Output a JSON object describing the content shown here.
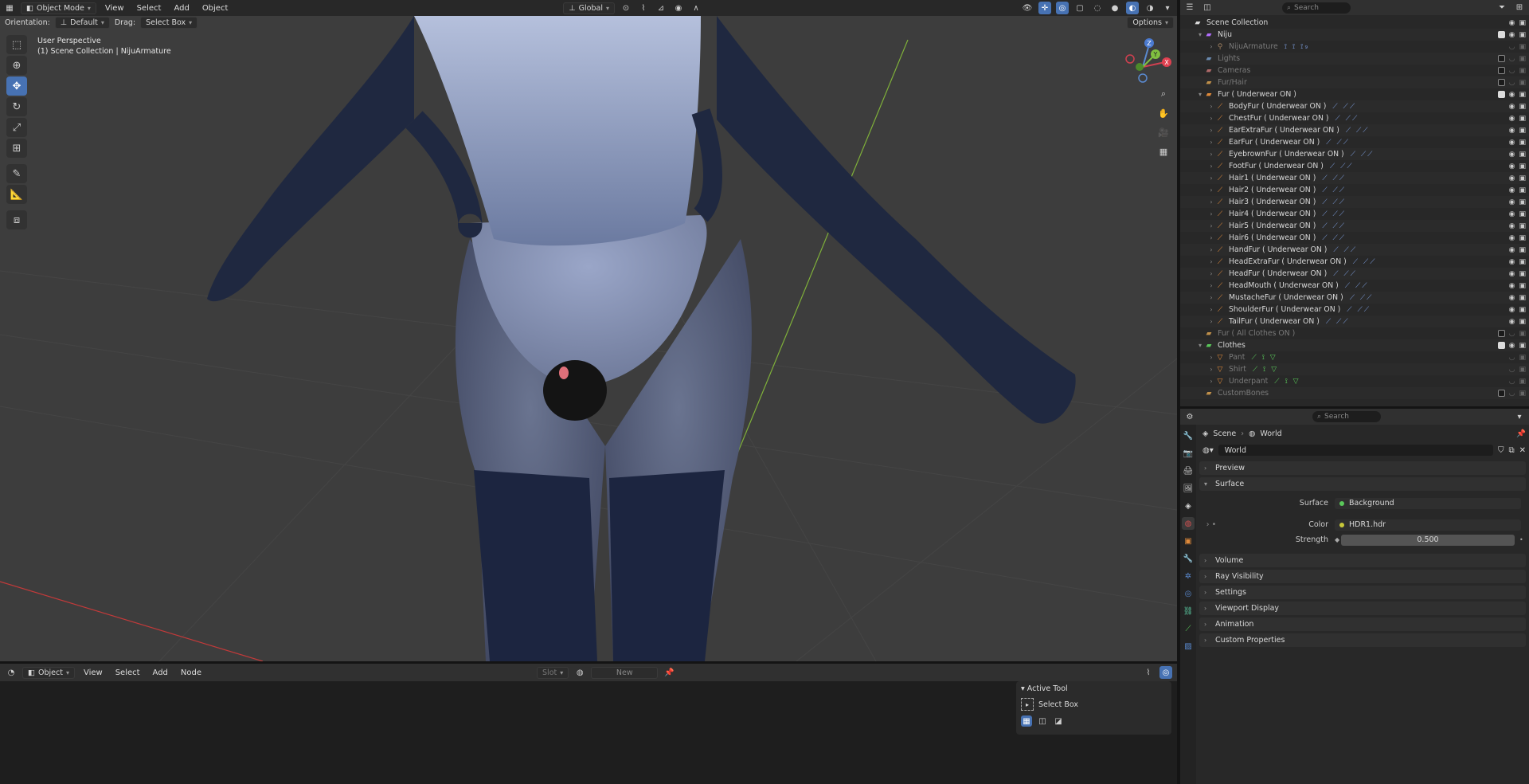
{
  "viewport": {
    "header": {
      "mode": "Object Mode",
      "menus": [
        "View",
        "Select",
        "Add",
        "Object"
      ],
      "transform": "Global"
    },
    "tool_settings": {
      "orientation_label": "Orientation:",
      "orientation_value": "Default",
      "drag_label": "Drag:",
      "drag_value": "Select Box",
      "options": "Options"
    },
    "info_line1": "User Perspective",
    "info_line2": "(1) Scene Collection | NijuArmature",
    "gizmo": {
      "x": "X",
      "y": "Y",
      "z": "Z"
    }
  },
  "node_editor": {
    "mode": "Object",
    "menus": [
      "View",
      "Select",
      "Add",
      "Node"
    ],
    "slot": "Slot",
    "new": "New",
    "active_tool": {
      "title": "Active Tool",
      "tool": "Select Box"
    }
  },
  "outliner": {
    "search_placeholder": "Search",
    "rows": [
      {
        "label": "Scene Collection",
        "indent": 0,
        "twisty": "",
        "icon": "collection-icon",
        "color": "#d8d8d8",
        "dim": false,
        "check": "",
        "extras": ""
      },
      {
        "label": "Niju",
        "indent": 1,
        "twisty": "▾",
        "icon": "collection-icon",
        "color": "#b36eff",
        "dim": false,
        "check": "on",
        "extras": ""
      },
      {
        "label": "NijuArmature",
        "indent": 2,
        "twisty": "›",
        "icon": "armature-icon",
        "color": "#a08060",
        "dim": true,
        "check": "",
        "extras": "⟟ ⟟ ⟟₉"
      },
      {
        "label": "Lights",
        "indent": 1,
        "twisty": "",
        "icon": "collection-icon",
        "color": "#6a8ab0",
        "dim": true,
        "check": "off",
        "extras": ""
      },
      {
        "label": "Cameras",
        "indent": 1,
        "twisty": "",
        "icon": "collection-icon",
        "color": "#b06a6a",
        "dim": true,
        "check": "off",
        "extras": ""
      },
      {
        "label": "Fur/Hair",
        "indent": 1,
        "twisty": "",
        "icon": "collection-icon",
        "color": "#c0904a",
        "dim": true,
        "check": "off",
        "extras": ""
      },
      {
        "label": "Fur ( Underwear ON )",
        "indent": 1,
        "twisty": "▾",
        "icon": "collection-icon",
        "color": "#e08a3a",
        "dim": false,
        "check": "on",
        "extras": ""
      },
      {
        "label": "BodyFur ( Underwear ON )",
        "indent": 2,
        "twisty": "›",
        "icon": "curves-icon",
        "color": "#e08a3a",
        "dim": false,
        "check": "",
        "extras": "⟋ ⟋⟋"
      },
      {
        "label": "ChestFur ( Underwear ON )",
        "indent": 2,
        "twisty": "›",
        "icon": "curves-icon",
        "color": "#e08a3a",
        "dim": false,
        "check": "",
        "extras": "⟋ ⟋⟋"
      },
      {
        "label": "EarExtraFur ( Underwear ON )",
        "indent": 2,
        "twisty": "›",
        "icon": "curves-icon",
        "color": "#e08a3a",
        "dim": false,
        "check": "",
        "extras": "⟋ ⟋⟋"
      },
      {
        "label": "EarFur ( Underwear ON )",
        "indent": 2,
        "twisty": "›",
        "icon": "curves-icon",
        "color": "#e08a3a",
        "dim": false,
        "check": "",
        "extras": "⟋ ⟋⟋"
      },
      {
        "label": "EyebrownFur ( Underwear ON )",
        "indent": 2,
        "twisty": "›",
        "icon": "curves-icon",
        "color": "#e08a3a",
        "dim": false,
        "check": "",
        "extras": "⟋ ⟋⟋"
      },
      {
        "label": "FootFur ( Underwear ON )",
        "indent": 2,
        "twisty": "›",
        "icon": "curves-icon",
        "color": "#e08a3a",
        "dim": false,
        "check": "",
        "extras": "⟋ ⟋⟋"
      },
      {
        "label": "Hair1 ( Underwear ON )",
        "indent": 2,
        "twisty": "›",
        "icon": "curves-icon",
        "color": "#e08a3a",
        "dim": false,
        "check": "",
        "extras": "⟋ ⟋⟋"
      },
      {
        "label": "Hair2 ( Underwear ON )",
        "indent": 2,
        "twisty": "›",
        "icon": "curves-icon",
        "color": "#e08a3a",
        "dim": false,
        "check": "",
        "extras": "⟋ ⟋⟋"
      },
      {
        "label": "Hair3 ( Underwear ON )",
        "indent": 2,
        "twisty": "›",
        "icon": "curves-icon",
        "color": "#e08a3a",
        "dim": false,
        "check": "",
        "extras": "⟋ ⟋⟋"
      },
      {
        "label": "Hair4 ( Underwear ON )",
        "indent": 2,
        "twisty": "›",
        "icon": "curves-icon",
        "color": "#e08a3a",
        "dim": false,
        "check": "",
        "extras": "⟋ ⟋⟋"
      },
      {
        "label": "Hair5 ( Underwear ON )",
        "indent": 2,
        "twisty": "›",
        "icon": "curves-icon",
        "color": "#e08a3a",
        "dim": false,
        "check": "",
        "extras": "⟋ ⟋⟋"
      },
      {
        "label": "Hair6 ( Underwear ON )",
        "indent": 2,
        "twisty": "›",
        "icon": "curves-icon",
        "color": "#e08a3a",
        "dim": false,
        "check": "",
        "extras": "⟋ ⟋⟋"
      },
      {
        "label": "HandFur ( Underwear ON )",
        "indent": 2,
        "twisty": "›",
        "icon": "curves-icon",
        "color": "#e08a3a",
        "dim": false,
        "check": "",
        "extras": "⟋ ⟋⟋"
      },
      {
        "label": "HeadExtraFur ( Underwear ON )",
        "indent": 2,
        "twisty": "›",
        "icon": "curves-icon",
        "color": "#e08a3a",
        "dim": false,
        "check": "",
        "extras": "⟋ ⟋⟋"
      },
      {
        "label": "HeadFur ( Underwear ON )",
        "indent": 2,
        "twisty": "›",
        "icon": "curves-icon",
        "color": "#e08a3a",
        "dim": false,
        "check": "",
        "extras": "⟋ ⟋⟋"
      },
      {
        "label": "HeadMouth ( Underwear ON )",
        "indent": 2,
        "twisty": "›",
        "icon": "curves-icon",
        "color": "#e08a3a",
        "dim": false,
        "check": "",
        "extras": "⟋ ⟋⟋"
      },
      {
        "label": "MustacheFur ( Underwear ON )",
        "indent": 2,
        "twisty": "›",
        "icon": "curves-icon",
        "color": "#e08a3a",
        "dim": false,
        "check": "",
        "extras": "⟋ ⟋⟋"
      },
      {
        "label": "ShoulderFur ( Underwear ON )",
        "indent": 2,
        "twisty": "›",
        "icon": "curves-icon",
        "color": "#e08a3a",
        "dim": false,
        "check": "",
        "extras": "⟋ ⟋⟋"
      },
      {
        "label": "TailFur ( Underwear ON )",
        "indent": 2,
        "twisty": "›",
        "icon": "curves-icon",
        "color": "#e08a3a",
        "dim": false,
        "check": "",
        "extras": "⟋ ⟋⟋"
      },
      {
        "label": "Fur ( All Clothes ON )",
        "indent": 1,
        "twisty": "",
        "icon": "collection-icon",
        "color": "#c0904a",
        "dim": true,
        "check": "off",
        "extras": ""
      },
      {
        "label": "Clothes",
        "indent": 1,
        "twisty": "▾",
        "icon": "collection-icon",
        "color": "#5ac85a",
        "dim": false,
        "check": "on",
        "extras": ""
      },
      {
        "label": "Pant",
        "indent": 2,
        "twisty": "›",
        "icon": "mesh-icon",
        "color": "#e08a3a",
        "dim": true,
        "check": "",
        "extras": "⟋ ⟟ ▽"
      },
      {
        "label": "Shirt",
        "indent": 2,
        "twisty": "›",
        "icon": "mesh-icon",
        "color": "#e08a3a",
        "dim": true,
        "check": "",
        "extras": "⟋ ⟟ ▽"
      },
      {
        "label": "Underpant",
        "indent": 2,
        "twisty": "›",
        "icon": "mesh-icon",
        "color": "#e08a3a",
        "dim": true,
        "check": "",
        "extras": "⟋ ⟟ ▽"
      },
      {
        "label": "CustomBones",
        "indent": 1,
        "twisty": "",
        "icon": "collection-icon",
        "color": "#c0904a",
        "dim": true,
        "check": "off",
        "extras": ""
      }
    ]
  },
  "properties": {
    "search_placeholder": "Search",
    "breadcrumb": {
      "scene": "Scene",
      "world": "World"
    },
    "world_name": "World",
    "panels": {
      "preview": "Preview",
      "surface": "Surface",
      "volume": "Volume",
      "ray_visibility": "Ray Visibility",
      "settings": "Settings",
      "viewport_display": "Viewport Display",
      "animation": "Animation",
      "custom_properties": "Custom Properties"
    },
    "surface": {
      "surface_label": "Surface",
      "surface_value": "Background",
      "color_label": "Color",
      "color_value": "HDR1.hdr",
      "strength_label": "Strength",
      "strength_value": "0.500"
    }
  }
}
